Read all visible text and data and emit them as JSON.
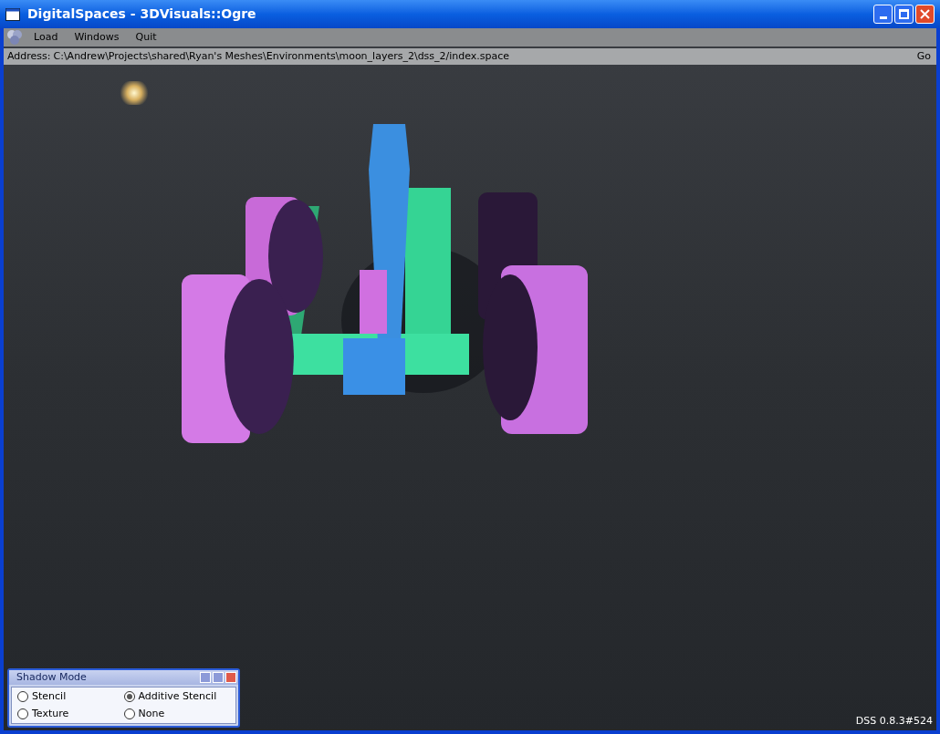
{
  "window": {
    "title": "DigitalSpaces - 3DVisuals::Ogre"
  },
  "menu": [
    {
      "label": "Load"
    },
    {
      "label": "Windows"
    },
    {
      "label": "Quit"
    }
  ],
  "address_bar": {
    "label": "Address:",
    "value": "C:\\Andrew\\Projects\\shared\\Ryan's Meshes\\Environments\\moon_layers_2\\dss_2/index.space",
    "go": "Go"
  },
  "shadow_mode": {
    "title": "Shadow Mode",
    "options": [
      {
        "label": "Stencil",
        "selected": false
      },
      {
        "label": "Additive Stencil",
        "selected": true
      },
      {
        "label": "Texture",
        "selected": false
      },
      {
        "label": "None",
        "selected": false
      }
    ]
  },
  "version": "DSS 0.8.3#524"
}
